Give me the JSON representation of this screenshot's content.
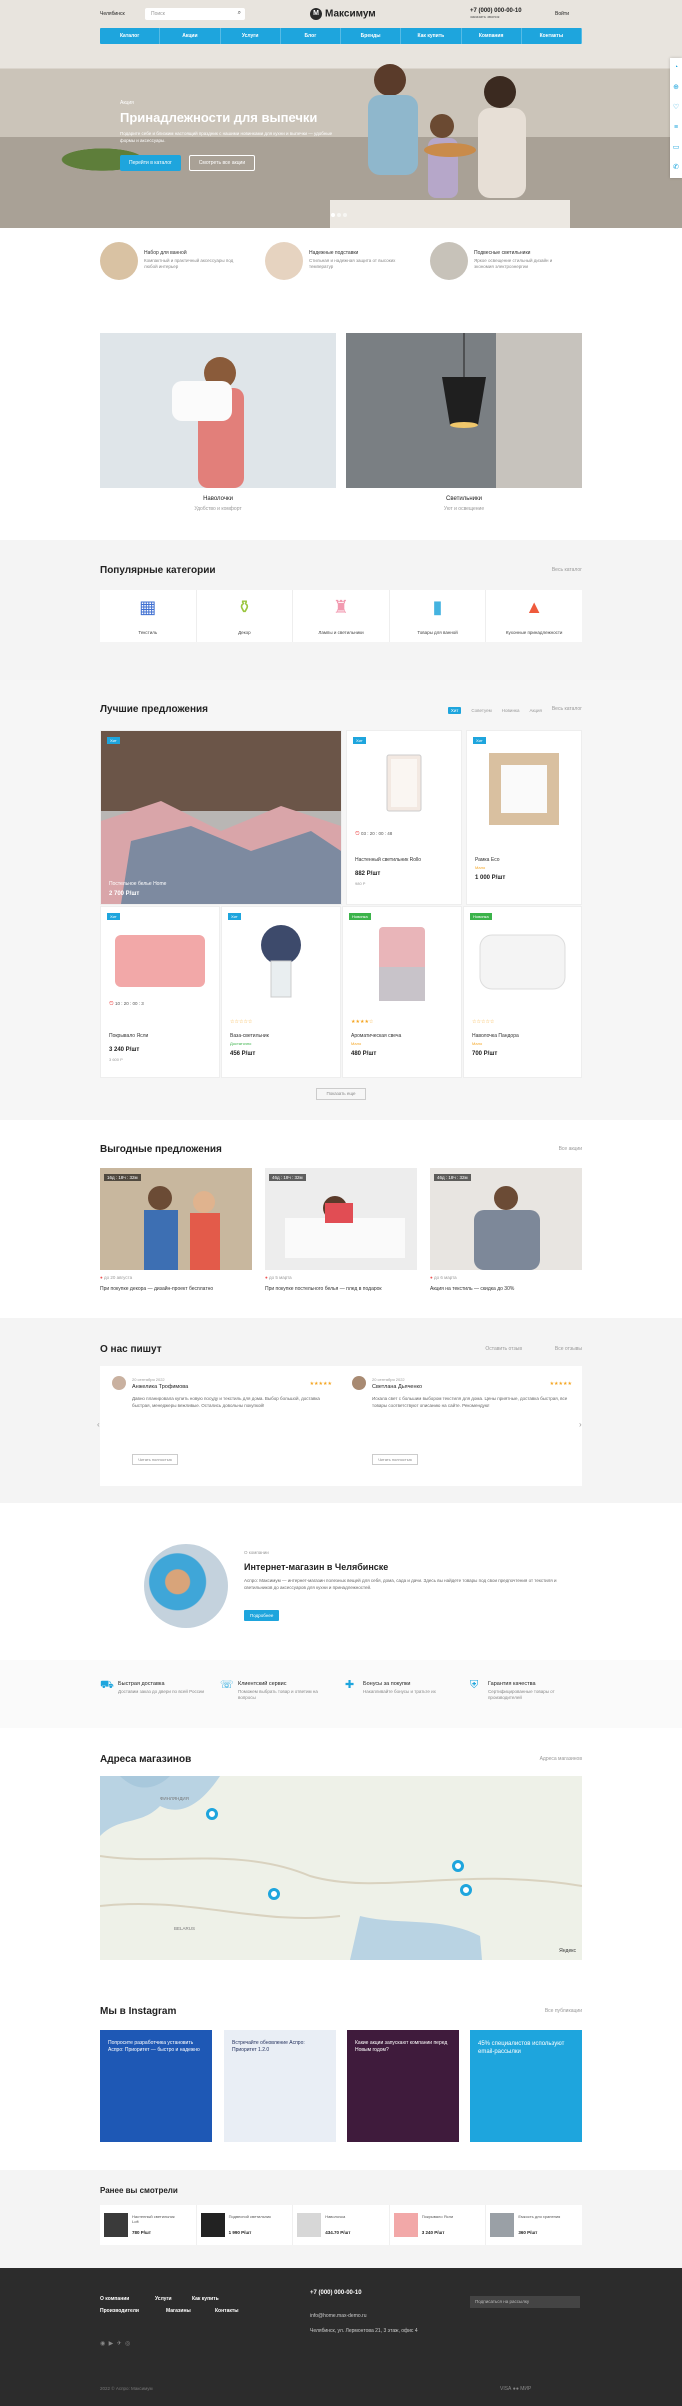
{
  "header": {
    "city": "Челябинск",
    "search_placeholder": "Поиск",
    "logo": "Максимум",
    "phone": "+7 (000) 000-00-10",
    "phone_sub": "заказать звонок",
    "login": "Войти",
    "nav": [
      "Каталог",
      "Акции",
      "Услуги",
      "Блог",
      "Бренды",
      "Как купить",
      "Компания",
      "Контакты"
    ]
  },
  "hero": {
    "small": "Акция",
    "title": "Принадлежности для выпечки",
    "text": "Подарите себе и близким настоящий праздник с нашими новинками для кухни и выпечки — удобные формы и аксессуары.",
    "btn_primary": "Перейти в каталог",
    "btn_secondary": "Смотреть все акции"
  },
  "features": [
    {
      "t1": "Набор для ванной",
      "t2": "Компактный и практичный аксессуары под любой интерьер",
      "color": "#d9c2a3"
    },
    {
      "t1": "Надежные подставки",
      "t2": "Стильная и надежная защита от высоких температур",
      "color": "#e6d3c0"
    },
    {
      "t1": "Подвесные светильники",
      "t2": "Яркое освещение стильный дизайн и экономия электроэнергии",
      "color": "#c7c2b9"
    }
  ],
  "banners": [
    {
      "title": "Наволочки",
      "sub": "Удобство и комфорт"
    },
    {
      "title": "Светильники",
      "sub": "Уют и освещение"
    }
  ],
  "categories": {
    "title": "Популярные категории",
    "see_all": "Весь каталог",
    "items": [
      {
        "label": "Текстиль",
        "icon": "textile-icon"
      },
      {
        "label": "Декор",
        "icon": "decor-icon"
      },
      {
        "label": "Лампы и светильники",
        "icon": "lamp-icon"
      },
      {
        "label": "Товары для ванной",
        "icon": "bath-icon"
      },
      {
        "label": "Кухонные принадлежности",
        "icon": "kitchen-icon"
      }
    ]
  },
  "products": {
    "title": "Лучшие предложения",
    "tabs": [
      "Хит",
      "Советуем",
      "Новинка",
      "Акция"
    ],
    "see_all": "Весь каталог",
    "more": "Показать еще",
    "items": [
      {
        "name": "Постельное белье Home",
        "price": "2 700 Р/шт",
        "badge": "Хит"
      },
      {
        "name": "Настенный светильник Rollo",
        "price": "882 Р/шт",
        "badge": "Хит",
        "old": "980 Р",
        "timer": [
          "03",
          "20",
          "00",
          "48"
        ]
      },
      {
        "name": "Рамка Eco",
        "price": "1 000 Р/шт",
        "badge": "Хит",
        "stock": "Мало"
      },
      {
        "name": "Покрывало Ясли",
        "price": "3 240 Р/шт",
        "badge": "Хит",
        "old": "3 600 Р",
        "timer": [
          "10",
          "20",
          "00",
          "3"
        ]
      },
      {
        "name": "Ваза-светильник",
        "price": "456 Р/шт",
        "badge": "Хит",
        "stock": "Достаточно"
      },
      {
        "name": "Ароматическая свеча",
        "price": "480 Р/шт",
        "badge": "Новинка",
        "stock": "Мало"
      },
      {
        "name": "Наволочка Пандора",
        "price": "700 Р/шт",
        "badge": "Новинка",
        "stock": "Мало"
      }
    ]
  },
  "promos": {
    "title": "Выгодные предложения",
    "see_all": "Все акции",
    "items": [
      {
        "counter": "16д : 18ч : 32м",
        "date": "до 20 августа",
        "title": "При покупке декора — дизайн-проект бесплатно"
      },
      {
        "counter": "46д : 18ч : 32м",
        "date": "до 5 марта",
        "title": "При покупке постельного белья — плед в подарок"
      },
      {
        "counter": "46д : 18ч : 32м",
        "date": "до 6 марта",
        "title": "Акция на текстиль — скидка до 30%"
      }
    ]
  },
  "reviews": {
    "title": "О нас пишут",
    "write": "Оставить отзыв",
    "see_all": "Все отзывы",
    "items": [
      {
        "date": "20 сентября 2022",
        "name": "Анжелика Трофимова",
        "text": "Давно планировала купить новую посуду и текстиль для дома. Выбор большой, доставка быстрая, менеджеры вежливые. Остались довольны покупкой!",
        "btn": "Читать полностью"
      },
      {
        "date": "20 сентября 2022",
        "name": "Светлана Дьяченко",
        "text": "Искала свет с большим выбором текстиля для дома. Цены приятные, доставка быстрая, все товары соответствуют описанию на сайте. Рекомендую!",
        "btn": "Читать полностью"
      }
    ]
  },
  "about": {
    "small": "О компании",
    "title": "Интернет-магазин в Челябинске",
    "text": "Аспро: Максимум — интернет-магазин полезных вещей для себя, дома, сада и дачи. Здесь вы найдете товары под свои предпочтения от текстиля и светильников до аксессуаров для кухни и принадлежностей.",
    "btn": "Подробнее"
  },
  "services": [
    {
      "t1": "Быстрая доставка",
      "t2": "Доставим заказ до двери по всей России"
    },
    {
      "t1": "Клиентский сервис",
      "t2": "Поможем выбрать товар и ответим на вопросы"
    },
    {
      "t1": "Бонусы за покупки",
      "t2": "Накапливайте бонусы и тратьте их"
    },
    {
      "t1": "Гарантия качества",
      "t2": "Сертифицированные товары от производителей"
    }
  ],
  "map": {
    "title": "Адреса магазинов",
    "see_all": "Адреса магазинов",
    "labels": [
      "ФИНЛЯНДИЯ",
      "BELARUS",
      "Яндекс"
    ]
  },
  "instagram": {
    "title": "Мы в Instagram",
    "link": "Все публикации",
    "items": [
      {
        "text": "Попросите разработчика установить Аспро: Приоритет — быстро и надежно",
        "bg": "#1e58b5"
      },
      {
        "text": "Встречайте обновление Аспро: Приоритет 1.2.0",
        "bg": "#e9eef5"
      },
      {
        "text": "Какие акции запускают компании перед Новым годом?",
        "bg": "#3f1b3c"
      },
      {
        "text": "45% специалистов используют email-рассылки",
        "bg": "#1ea5dd"
      }
    ]
  },
  "recent": {
    "title": "Ранее вы смотрели",
    "items": [
      {
        "name": "Настенный светильник Loft",
        "price": "780 Р/шт"
      },
      {
        "name": "Подвесной светильник",
        "price": "1 990 Р/шт"
      },
      {
        "name": "Наволочка",
        "price": "434.70 Р/шт"
      },
      {
        "name": "Покрывало Ясли",
        "price": "3 240 Р/шт"
      },
      {
        "name": "Емкость для хранения",
        "price": "360 Р/шт"
      }
    ]
  },
  "footer": {
    "cols": [
      "О компании",
      "Услуги",
      "Как купить",
      "Производители",
      "Магазины",
      "Контакты"
    ],
    "phone": "+7 (000) 000-00-10",
    "email": "info@home.max-demo.ru",
    "address": "Челябинск, ул. Лермонтова 21, 3 этаж, офис 4",
    "subscribe": "Подписаться на рассылку",
    "copyright": "2022 © Аспро: Максимум"
  }
}
